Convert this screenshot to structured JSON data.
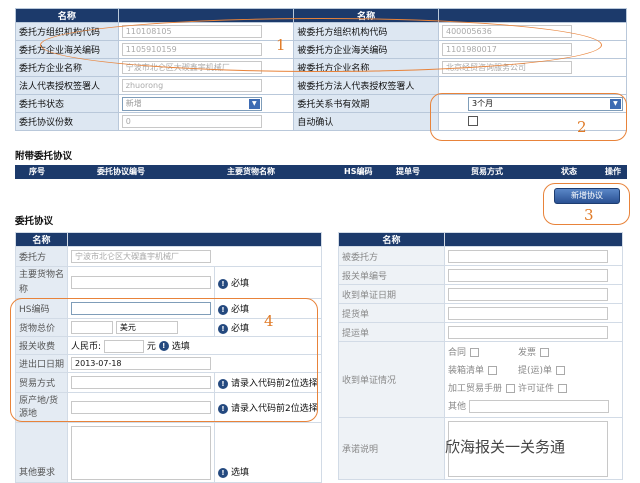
{
  "top": {
    "hdr_left": "名称",
    "hdr_right": "名称",
    "rows": [
      {
        "l1": "委托方组织机构代码",
        "v1": "110108105",
        "l2": "被委托方组织机构代码",
        "v2": "400005636"
      },
      {
        "l1": "委托方企业海关编码",
        "v1": "1105910159",
        "l2": "被委托方企业海关编码",
        "v2": "1101980017"
      },
      {
        "l1": "委托方企业名称",
        "v1": "宁波市北仑区大碶鑫宇机械厂",
        "l2": "被委托方企业名称",
        "v2": "北京经贸咨询服务公司"
      },
      {
        "l1": "法人代表授权签署人",
        "v1": "zhuorong",
        "l2": "被委托方法人代表授权签署人",
        "v2": ""
      },
      {
        "l1": "委托书状态",
        "v1": "新增",
        "l2": "委托关系书有效期",
        "v2": "3个月"
      },
      {
        "l1": "委托协议份数",
        "v1": "0",
        "l2": "自动确认",
        "v2": ""
      }
    ]
  },
  "attached": {
    "title": "附带委托协议",
    "cols": [
      "序号",
      "委托协议编号",
      "主要货物名称",
      "HS编码",
      "提单号",
      "贸易方式",
      "状态",
      "操作"
    ],
    "add_button": "新增协议"
  },
  "agreement": {
    "title": "委托协议",
    "left_hdr": "名称",
    "right_hdr": "名称",
    "client_label": "委托方",
    "client_value": "宁波市北仑区大碶鑫宇机械厂",
    "goods_label": "主要货物名称",
    "required": "必填",
    "hs_label": "HS编码",
    "price_label": "货物总价",
    "currency": "美元",
    "fee_label": "报关收费",
    "rmb": "人民币:",
    "yuan": "元",
    "optional": "选填",
    "date_label": "进出口日期",
    "date_value": "2013-07-18",
    "trade_label": "贸易方式",
    "enter_hint": "请录入代码前2位选择",
    "origin_label": "原产地/货源地",
    "other_label": "其他要求",
    "other_opt": "选填",
    "right_labels": [
      "被委托方",
      "报关单编号",
      "收到单证日期",
      "提货单",
      "提运单"
    ],
    "docs_label": "收到单证情况",
    "docs": [
      [
        "合同",
        "发票"
      ],
      [
        "装箱清单",
        "提(运)单"
      ],
      [
        "加工贸易手册",
        "许可证件"
      ]
    ],
    "docs_other": "其他",
    "promise_label": "承诺说明"
  },
  "annotations": [
    "1",
    "2",
    "3",
    "4"
  ],
  "watermark": "欣海报关一关务通"
}
